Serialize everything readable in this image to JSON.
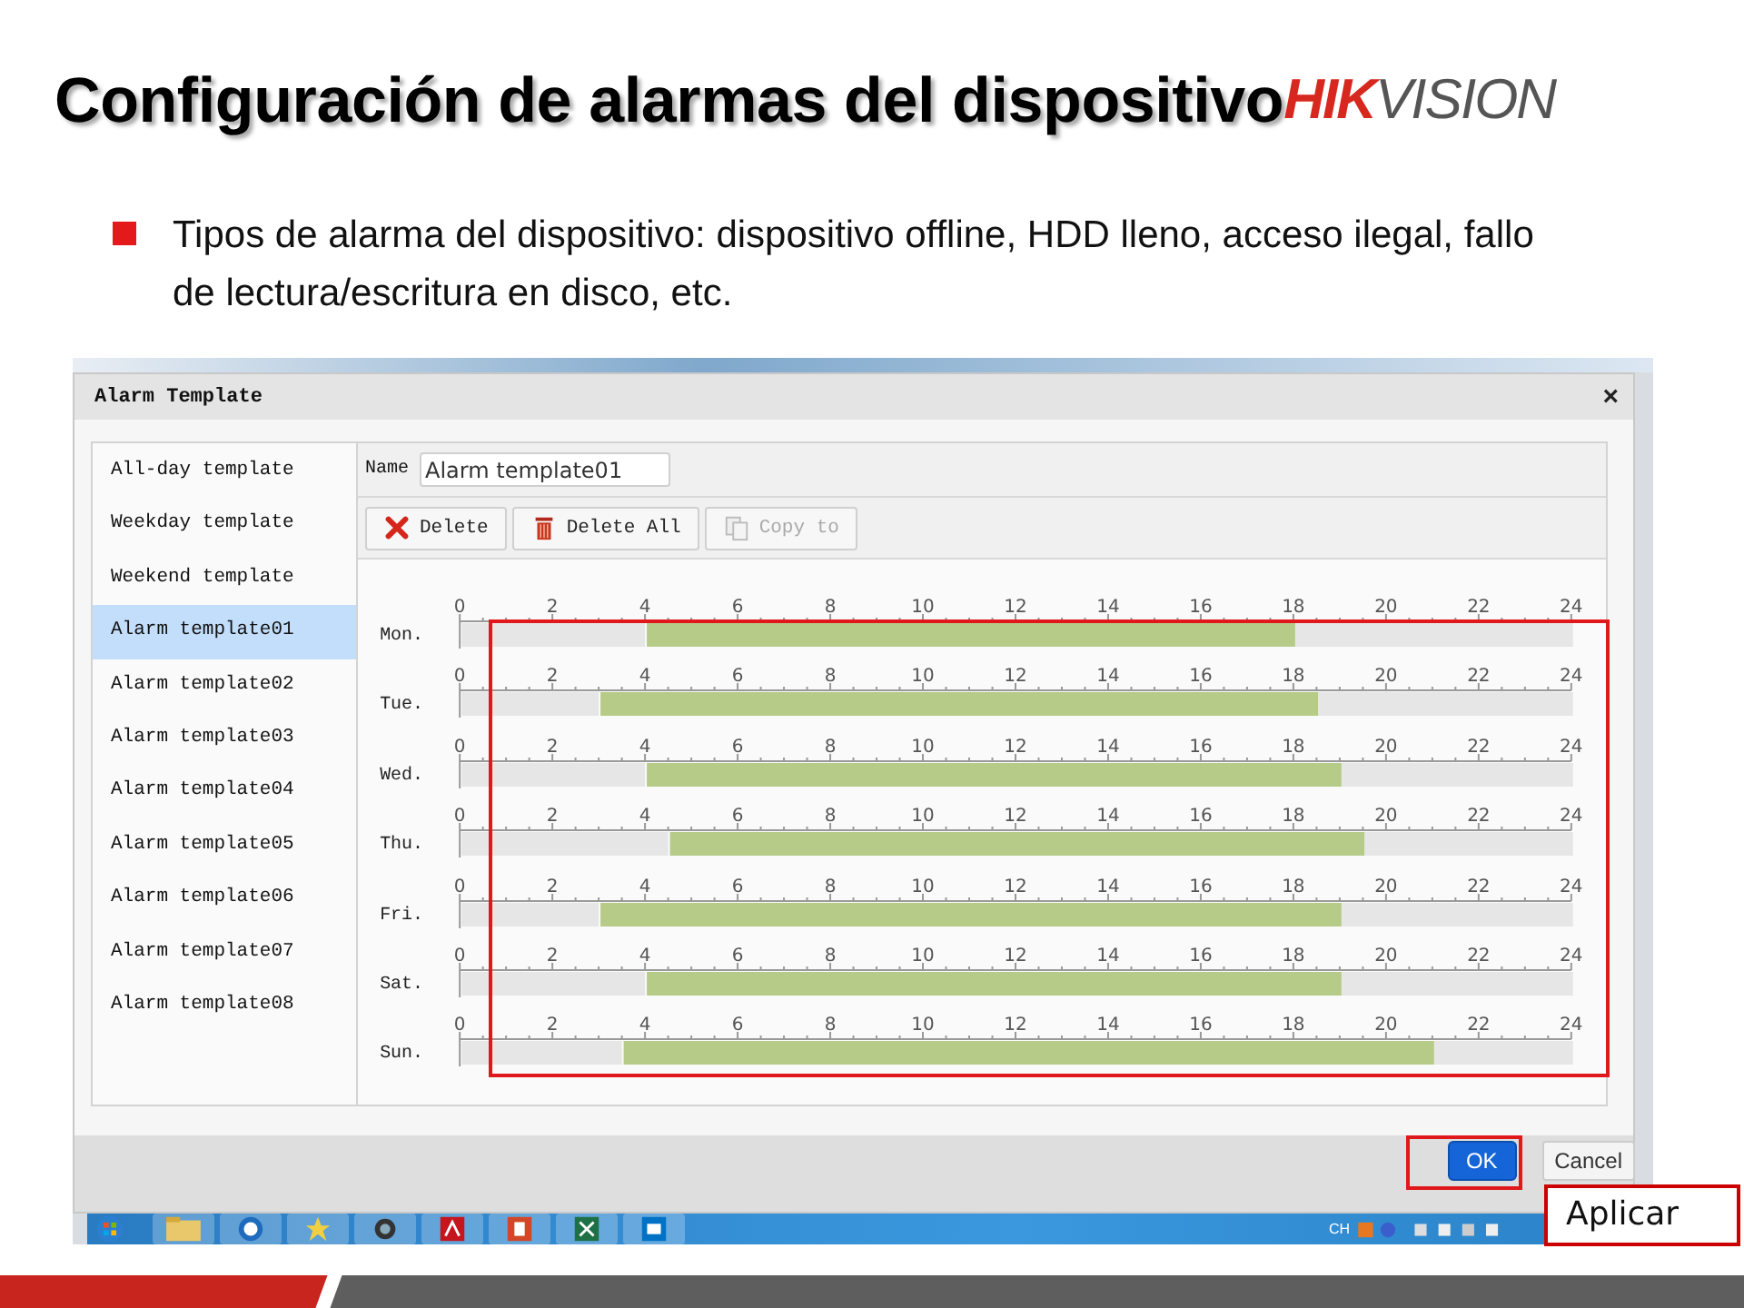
{
  "slide": {
    "title": "Configuración de alarmas del dispositivo",
    "logo": {
      "part_1": "HIK",
      "part_2": "VISION"
    },
    "bullets": [
      "Tipos de alarma del dispositivo: dispositivo offline, HDD lleno, acceso ilegal, fallo de lectura/escritura en disco, etc."
    ]
  },
  "dialog": {
    "title": "Alarm Template",
    "close": "×",
    "templates": [
      {
        "label": "All-day template",
        "selected": false
      },
      {
        "label": "Weekday template",
        "selected": false
      },
      {
        "label": "Weekend template",
        "selected": false
      },
      {
        "label": "Alarm template01",
        "selected": true
      },
      {
        "label": "Alarm template02",
        "selected": false
      },
      {
        "label": "Alarm template03",
        "selected": false
      },
      {
        "label": "Alarm template04",
        "selected": false
      },
      {
        "label": "Alarm template05",
        "selected": false
      },
      {
        "label": "Alarm template06",
        "selected": false
      },
      {
        "label": "Alarm template07",
        "selected": false
      },
      {
        "label": "Alarm template08",
        "selected": false
      }
    ],
    "name_label": "Name",
    "name_value": "Alarm template01",
    "toolbar": [
      {
        "label": "Delete",
        "kind": "delete",
        "disabled": false
      },
      {
        "label": "Delete All",
        "kind": "trash",
        "disabled": false
      },
      {
        "label": "Copy to",
        "kind": "copy",
        "disabled": true
      }
    ],
    "schedule": [
      {
        "chart_data": {
          "type": "bar",
          "orientation": "horizontal",
          "stacked": true,
          "categories": [
            "Mon."
          ],
          "xlim": [
            0,
            24
          ],
          "xticks": [
            0,
            2,
            4,
            6,
            8,
            10,
            12,
            14,
            16,
            18,
            20,
            22,
            24
          ],
          "series": [
            {
              "color": "#e6e6e6",
              "values": [
                4
              ]
            },
            {
              "color": "#b5cb87",
              "values": [
                14
              ]
            },
            {
              "color": "#e6e6e6",
              "values": [
                6
              ]
            }
          ]
        }
      },
      {
        "chart_data": {
          "type": "bar",
          "orientation": "horizontal",
          "stacked": true,
          "categories": [
            "Tue."
          ],
          "xlim": [
            0,
            24
          ],
          "xticks": [
            0,
            2,
            4,
            6,
            8,
            10,
            12,
            14,
            16,
            18,
            20,
            22,
            24
          ],
          "series": [
            {
              "color": "#e6e6e6",
              "values": [
                3
              ]
            },
            {
              "color": "#b5cb87",
              "values": [
                15.5
              ]
            },
            {
              "color": "#e6e6e6",
              "values": [
                5.5
              ]
            }
          ]
        }
      },
      {
        "chart_data": {
          "type": "bar",
          "orientation": "horizontal",
          "stacked": true,
          "categories": [
            "Wed."
          ],
          "xlim": [
            0,
            24
          ],
          "xticks": [
            0,
            2,
            4,
            6,
            8,
            10,
            12,
            14,
            16,
            18,
            20,
            22,
            24
          ],
          "series": [
            {
              "color": "#e6e6e6",
              "values": [
                4
              ]
            },
            {
              "color": "#b5cb87",
              "values": [
                15
              ]
            },
            {
              "color": "#e6e6e6",
              "values": [
                5
              ]
            }
          ]
        }
      },
      {
        "chart_data": {
          "type": "bar",
          "orientation": "horizontal",
          "stacked": true,
          "categories": [
            "Thu."
          ],
          "xlim": [
            0,
            24
          ],
          "xticks": [
            0,
            2,
            4,
            6,
            8,
            10,
            12,
            14,
            16,
            18,
            20,
            22,
            24
          ],
          "series": [
            {
              "color": "#e6e6e6",
              "values": [
                4.5
              ]
            },
            {
              "color": "#b5cb87",
              "values": [
                15
              ]
            },
            {
              "color": "#e6e6e6",
              "values": [
                4.5
              ]
            }
          ]
        }
      },
      {
        "chart_data": {
          "type": "bar",
          "orientation": "horizontal",
          "stacked": true,
          "categories": [
            "Fri."
          ],
          "xlim": [
            0,
            24
          ],
          "xticks": [
            0,
            2,
            4,
            6,
            8,
            10,
            12,
            14,
            16,
            18,
            20,
            22,
            24
          ],
          "series": [
            {
              "color": "#e6e6e6",
              "values": [
                3
              ]
            },
            {
              "color": "#b5cb87",
              "values": [
                16
              ]
            },
            {
              "color": "#e6e6e6",
              "values": [
                5
              ]
            }
          ]
        }
      },
      {
        "chart_data": {
          "type": "bar",
          "orientation": "horizontal",
          "stacked": true,
          "categories": [
            "Sat."
          ],
          "xlim": [
            0,
            24
          ],
          "xticks": [
            0,
            2,
            4,
            6,
            8,
            10,
            12,
            14,
            16,
            18,
            20,
            22,
            24
          ],
          "series": [
            {
              "color": "#e6e6e6",
              "values": [
                4
              ]
            },
            {
              "color": "#b5cb87",
              "values": [
                15
              ]
            },
            {
              "color": "#e6e6e6",
              "values": [
                5
              ]
            }
          ]
        }
      },
      {
        "chart_data": {
          "type": "bar",
          "orientation": "horizontal",
          "stacked": true,
          "categories": [
            "Sun."
          ],
          "xlim": [
            0,
            24
          ],
          "xticks": [
            0,
            2,
            4,
            6,
            8,
            10,
            12,
            14,
            16,
            18,
            20,
            22,
            24
          ],
          "series": [
            {
              "color": "#e6e6e6",
              "values": [
                3.5
              ]
            },
            {
              "color": "#b5cb87",
              "values": [
                17.5
              ]
            },
            {
              "color": "#e6e6e6",
              "values": [
                3
              ]
            }
          ]
        }
      }
    ],
    "buttons": [
      {
        "label": "OK",
        "kind": "primary"
      },
      {
        "label": "Cancel",
        "kind": "secondary"
      }
    ]
  },
  "taskbar": {
    "tray_label": "CH"
  },
  "callout": {
    "label": "Aplicar"
  }
}
